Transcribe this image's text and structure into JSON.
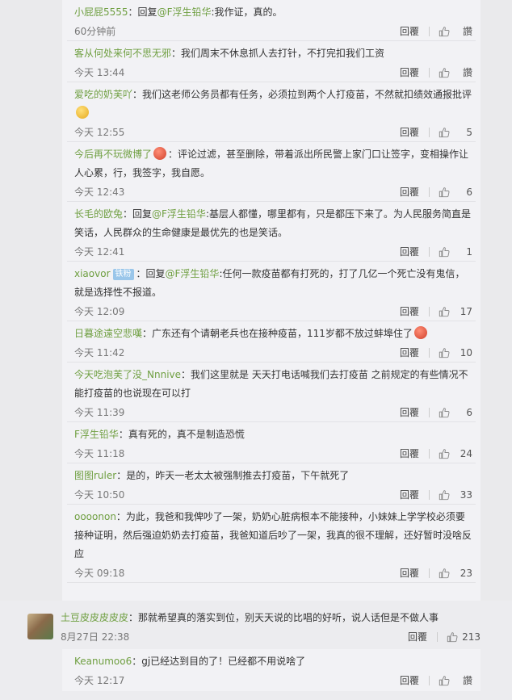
{
  "replies": [
    {
      "user": "小屁屁5555",
      "segments": [
        {
          "t": "：回复",
          "c": "text"
        },
        {
          "t": "@F浮生铅华",
          "c": "mention"
        },
        {
          "t": ":我作证，真的。",
          "c": "text"
        }
      ],
      "time": "60分钟前",
      "reply": "回覆",
      "likes": "讚"
    },
    {
      "user": "客从何处来何不思无邪",
      "segments": [
        {
          "t": "：我们周末不休息抓人去打针，不打完扣我们工资",
          "c": "text"
        }
      ],
      "time": "今天 13:44",
      "reply": "回覆",
      "likes": "讚"
    },
    {
      "user": "爱吃的奶芙吖",
      "segments": [
        {
          "t": "：我们这老师公务员都有任务，必须拉到两个人打疫苗，不然就扣绩效通报批评",
          "c": "text"
        },
        {
          "t": "",
          "c": "emoji-yellow"
        }
      ],
      "time": "今天 12:55",
      "reply": "回覆",
      "likes": "5"
    },
    {
      "user": "今后再不玩微博了",
      "segments": [
        {
          "t": "",
          "c": "emoji-red"
        },
        {
          "t": "：评论过滤，甚至删除，带着派出所民警上家门口让签字，变相操作让人心累，行，我签字，我自愿。",
          "c": "text"
        }
      ],
      "time": "今天 12:43",
      "reply": "回覆",
      "likes": "6"
    },
    {
      "user": "长毛的欧兔",
      "segments": [
        {
          "t": "：回复",
          "c": "text"
        },
        {
          "t": "@F浮生铅华",
          "c": "mention"
        },
        {
          "t": ":基层人都懂，哪里都有，只是都压下来了。为人民服务简直是笑话，人民群众的生命健康是最优先的也是笑话。",
          "c": "text"
        }
      ],
      "time": "今天 12:41",
      "reply": "回覆",
      "likes": "1"
    },
    {
      "user": "xiaovor",
      "badge": "铁粉",
      "segments": [
        {
          "t": "：回复",
          "c": "text"
        },
        {
          "t": "@F浮生铅华",
          "c": "mention"
        },
        {
          "t": ":任何一款疫苗都有打死的，打了几亿一个死亡没有鬼信，就是选择性不报道。",
          "c": "text"
        }
      ],
      "time": "今天 12:09",
      "reply": "回覆",
      "likes": "17"
    },
    {
      "user": "日暮途遠空悲嘆",
      "segments": [
        {
          "t": "：广东还有个请朝老兵也在接种疫苗，111岁都不放过蚌埠住了",
          "c": "text"
        },
        {
          "t": "",
          "c": "emoji-red"
        }
      ],
      "time": "今天 11:42",
      "reply": "回覆",
      "likes": "10"
    },
    {
      "user": "今天吃泡芙了没_Nnnive",
      "segments": [
        {
          "t": "：我们这里就是  天天打电话喊我们去打疫苗  之前规定的有些情况不能打疫苗的也说现在可以打",
          "c": "text"
        }
      ],
      "time": "今天 11:39",
      "reply": "回覆",
      "likes": "6"
    },
    {
      "user": "F浮生铅华",
      "segments": [
        {
          "t": "：真有死的，真不是制造恐慌",
          "c": "text"
        }
      ],
      "time": "今天 11:18",
      "reply": "回覆",
      "likes": "24"
    },
    {
      "user": "图图ruler",
      "segments": [
        {
          "t": "：是的，昨天一老太太被强制推去打疫苗，下午就死了",
          "c": "text"
        }
      ],
      "time": "今天 10:50",
      "reply": "回覆",
      "likes": "33"
    },
    {
      "user": "oooonon",
      "segments": [
        {
          "t": "：为此，我爸和我俾吵了一架，奶奶心脏病根本不能接种，小妹妹上学学校必须要接种证明，然后强迫奶奶去打疫苗，我爸知道后吵了一架，我真的很不理解，还好暂时没啥反应",
          "c": "text"
        }
      ],
      "time": "今天 09:18",
      "reply": "回覆",
      "likes": "23"
    }
  ],
  "comment": {
    "user": "土豆皮皮皮皮皮",
    "text": "：那就希望真的落实到位，别天天说的比唱的好听，说人话但是不做人事",
    "time": "8月27日 22:38",
    "reply": "回覆",
    "likes": "213"
  },
  "nested_reply": {
    "user": "Keanumoo6",
    "text": "：gj已经达到目的了！已经都不用说啥了",
    "time": "今天 12:17",
    "reply": "回覆",
    "likes": "讚"
  },
  "colors": {
    "username": "#6f9f41",
    "badge": "#9ac6ea",
    "panel": "#f2f2f5",
    "page": "#eaeaec"
  },
  "icons": {
    "like": "thumbs-up-icon",
    "avatar": "user-avatar"
  }
}
